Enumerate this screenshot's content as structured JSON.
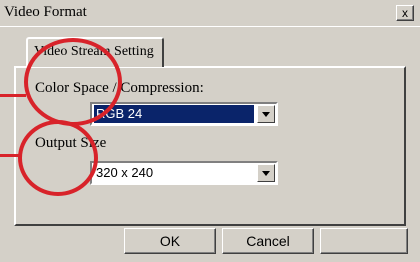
{
  "window": {
    "title": "Video Format",
    "close_glyph": "x"
  },
  "tab": {
    "label": "Video Stream Setting"
  },
  "form": {
    "color_space_label": "Color Space / Compression:",
    "color_space_value": "RGB 24",
    "output_size_label": "Output Size",
    "output_size_value": "320 x 240"
  },
  "buttons": {
    "ok": "OK",
    "cancel": "Cancel",
    "blank": ""
  },
  "annotation": {
    "highlight_color": "#d8232a"
  }
}
